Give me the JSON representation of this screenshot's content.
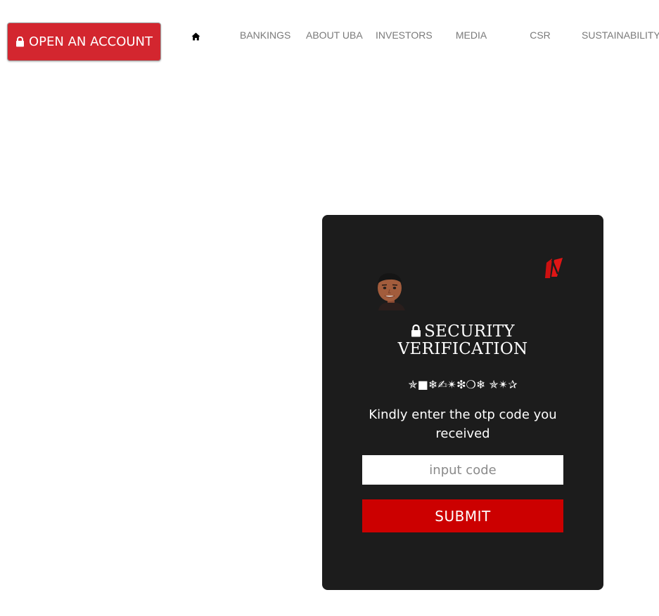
{
  "header": {
    "open_account_label": "OPEN AN ACCOUNT",
    "open_account_icon": "lock-icon",
    "home_icon": "home-icon",
    "nav": [
      {
        "label": "BANKINGS"
      },
      {
        "label": "ABOUT UBA"
      },
      {
        "label": "INVESTORS"
      },
      {
        "label": "MEDIA"
      },
      {
        "label": "CSR"
      },
      {
        "label": "SUSTAINABILITY"
      }
    ]
  },
  "card": {
    "avatar_icon": "user-avatar",
    "logo_icon": "brand-logo-icon",
    "title_line1": "SECURITY",
    "title_line2": "VERIFICATION",
    "symbols": "✯■❄✍✴❇❍❄ ✯✴✰",
    "instruction": "Kindly enter the otp code you received",
    "input_placeholder": "input code",
    "input_value": "",
    "submit_label": "SUBMIT"
  },
  "colors": {
    "open_account_bg": "#d3262f",
    "card_bg": "#1c1c1c",
    "submit_bg": "#cc0000",
    "nav_text": "#7a7a7a"
  }
}
